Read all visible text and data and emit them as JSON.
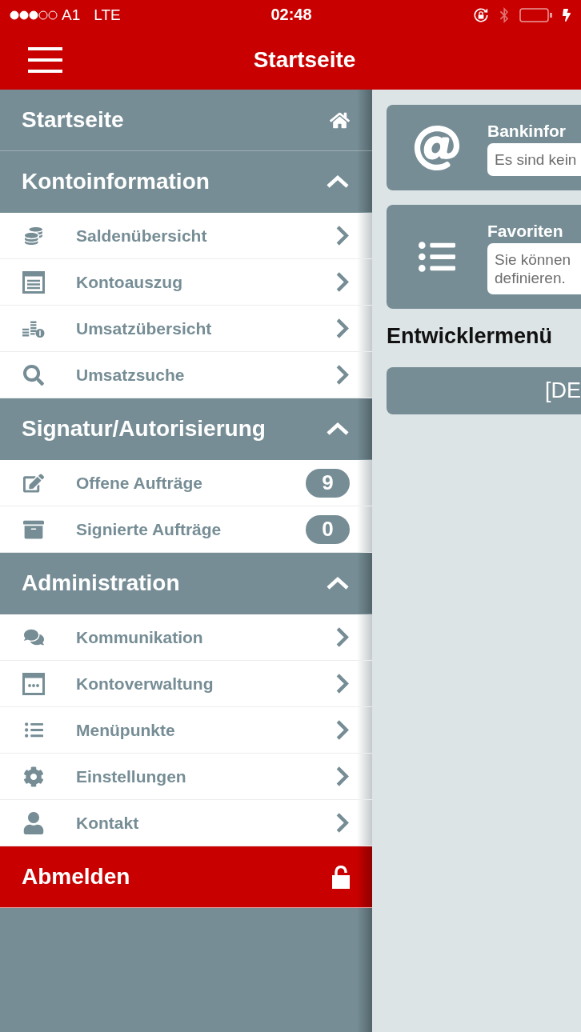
{
  "status_bar": {
    "carrier": "A1",
    "network": "LTE",
    "time": "02:48"
  },
  "header": {
    "title": "Startseite"
  },
  "sidebar": {
    "home": {
      "label": "Startseite"
    },
    "sections": [
      {
        "title": "Kontoinformation",
        "expanded": true,
        "items": [
          {
            "label": "Saldenübersicht"
          },
          {
            "label": "Kontoauszug"
          },
          {
            "label": "Umsatzübersicht"
          },
          {
            "label": "Umsatzsuche"
          }
        ]
      },
      {
        "title": "Signatur/Autorisierung",
        "expanded": true,
        "items": [
          {
            "label": "Offene Aufträge",
            "badge": "9"
          },
          {
            "label": "Signierte Aufträge",
            "badge": "0"
          }
        ]
      },
      {
        "title": "Administration",
        "expanded": true,
        "items": [
          {
            "label": "Kommunikation"
          },
          {
            "label": "Kontoverwaltung"
          },
          {
            "label": "Menüpunkte"
          },
          {
            "label": "Einstellungen"
          },
          {
            "label": "Kontakt"
          }
        ]
      }
    ],
    "logout": {
      "label": "Abmelden"
    }
  },
  "main": {
    "cards": [
      {
        "title": "Bankinfor",
        "message": "Es sind kein"
      },
      {
        "title": "Favoriten",
        "message": "Sie können\ndefinieren."
      }
    ],
    "developer": {
      "heading": "Entwicklermenü",
      "button": "[DE"
    }
  }
}
